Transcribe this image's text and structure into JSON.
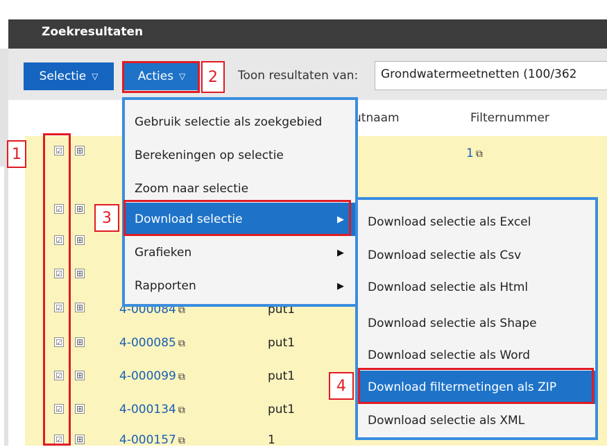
{
  "panel": {
    "title": "Zoekresultaten"
  },
  "toolbar": {
    "selectie_label": "Selectie",
    "acties_label": "Acties",
    "caret": "▽",
    "toon_label": "Toon resultaten van:",
    "toon_value": "Grondwatermeetnetten (100/362"
  },
  "columns": {
    "putnaam": "utnaam",
    "filternummer": "Filternummer"
  },
  "rows": [
    {
      "link": "",
      "put": "",
      "filter": "1"
    },
    {
      "link": "4-000084",
      "put": "put1",
      "filter": ""
    },
    {
      "link": "4-000085",
      "put": "put1",
      "filter": ""
    },
    {
      "link": "4-000099",
      "put": "put1",
      "filter": ""
    },
    {
      "link": "4-000134",
      "put": "put1",
      "filter": ""
    },
    {
      "link": "4-000157",
      "put": "1",
      "filter": ""
    }
  ],
  "acties_menu": {
    "items": [
      {
        "label": "Gebruik selectie als zoekgebied"
      },
      {
        "label": "Berekeningen op selectie"
      },
      {
        "label": "Zoom naar selectie"
      },
      {
        "label": "Download selectie"
      },
      {
        "label": "Grafieken"
      },
      {
        "label": "Rapporten"
      }
    ]
  },
  "download_menu": {
    "items": [
      {
        "label": "Download selectie als Excel"
      },
      {
        "label": "Download selectie als Csv"
      },
      {
        "label": "Download selectie als Html"
      },
      {
        "label": "Download selectie als Shape"
      },
      {
        "label": "Download selectie als Word"
      },
      {
        "label": "Download filtermetingen als ZIP"
      },
      {
        "label": "Download selectie als XML"
      }
    ]
  },
  "annotations": {
    "one": "1",
    "two": "2",
    "three": "3",
    "four": "4"
  },
  "icons": {
    "check": "☑",
    "plus": "⊞",
    "ext": "⧉",
    "arrow": "▶"
  },
  "colors": {
    "accent": "#1e73c8",
    "highlight": "#e01b24",
    "row": "#fbf4bd",
    "menu_border": "#3a8ddf"
  }
}
